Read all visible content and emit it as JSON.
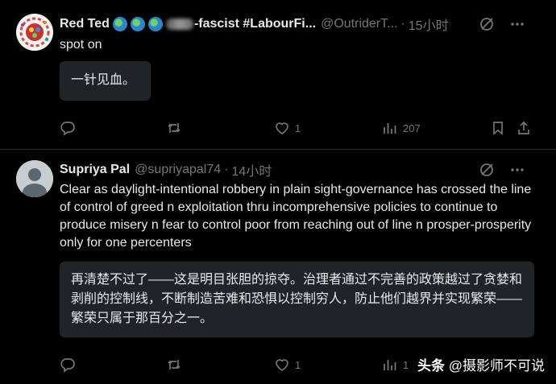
{
  "tweets": [
    {
      "display_name": "Red Ted",
      "name_suffix": "-fascist #LabourFi...",
      "handle": "@OutriderT...",
      "separator": "·",
      "time": "15小时",
      "text": "spot on",
      "translation": "一针见血。",
      "actions": {
        "replies": "",
        "retweets": "",
        "likes": "1",
        "views": "207"
      }
    },
    {
      "display_name": "Supriya Pal",
      "handle": "@supriyapal74",
      "separator": "·",
      "time": "14小时",
      "text": "Clear as daylight-intentional robbery in plain sight-governance has crossed the line of control of greed n exploitation thru incomprehensive policies to continue to produce misery n fear to control poor from reaching out of line n prosper-prosperity only for one percenters",
      "translation": "再清楚不过了——这是明目张胆的掠夺。治理者通过不完善的政策越过了贪婪和剥削的控制线，不断制造苦难和恐惧以控制穷人，防止他们越界并实现繁荣——繁荣只属于那百分之一。",
      "actions": {
        "replies": "",
        "retweets": "",
        "likes": "1",
        "views": "1"
      }
    }
  ],
  "watermark": {
    "brand": "头条",
    "account": "@摄影师不可说"
  },
  "colors": {
    "background": "#000000",
    "text": "#e7e9ea",
    "muted": "#71767b",
    "translation_bg": "#202327",
    "divider": "#2f3336"
  },
  "icons": [
    "reply-icon",
    "retweet-icon",
    "like-icon",
    "views-icon",
    "bookmark-icon",
    "share-icon",
    "grok-icon",
    "more-icon",
    "globe-emoji"
  ]
}
